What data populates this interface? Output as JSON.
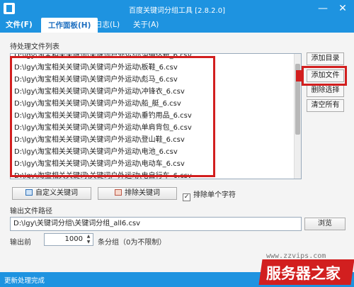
{
  "window": {
    "title": "百度关键词分组工具 [2.8.2.0]",
    "min_glyph": "—",
    "close_glyph": "✕"
  },
  "menu": {
    "file": "文件(F)",
    "workspace": "工作面板(H)",
    "log": "日志(L)",
    "about": "关于(A)"
  },
  "pending": {
    "label": "待处理文件列表",
    "files": [
      "D:\\lgy\\淘宝相关关键词\\关键词户外运动\\沟通达新_6.csv",
      "D:\\lgy\\淘宝相关关键词\\关键词户外运动\\板鞋_6.csv",
      "D:\\lgy\\淘宝相关关键词\\关键词户外运动\\彪马_6.csv",
      "D:\\lgy\\淘宝相关关键词\\关键词户外运动\\冲锋衣_6.csv",
      "D:\\lgy\\淘宝相关关键词\\关键词户外运动\\船_艇_6.csv",
      "D:\\lgy\\淘宝相关关键词\\关键词户外运动\\垂钓用品_6.csv",
      "D:\\lgy\\淘宝相关关键词\\关键词户外运动\\单肩背包_6.csv",
      "D:\\lgy\\淘宝相关关键词\\关键词户外运动\\登山鞋_6.csv",
      "D:\\lgy\\淘宝相关关键词\\关键词户外运动\\电池_6.csv",
      "D:\\lgy\\淘宝相关关键词\\关键词户外运动\\电动车_6.csv",
      "D:\\lgy\\淘宝相关关键词\\关键词户外运动\\电自行车_6.csv"
    ]
  },
  "side_buttons": {
    "add_dir": "添加目录",
    "add_file": "添加文件",
    "remove_selected": "删除选择",
    "clear_all": "清空所有"
  },
  "keywords": {
    "custom": "自定义关键词",
    "exclude": "排除关键词",
    "exclude_single": "排除单个字符",
    "exclude_single_checked": true,
    "check_glyph": "✓"
  },
  "output": {
    "label": "输出文件路径",
    "path": "D:\\lgy\\关键词分组\\关键词分组_all6.csv",
    "browse": "浏览"
  },
  "groups": {
    "before_label": "输出前",
    "count": "1000",
    "after_label": "条分组（0为不限制）",
    "up_glyph": "▲",
    "down_glyph": "▼"
  },
  "status": {
    "text": "更新处理完成"
  },
  "watermark": {
    "url": "www.zzvips.com",
    "brand": "服务器之家"
  },
  "colors": {
    "accent": "#1e93e0",
    "highlight": "#d21f1f"
  }
}
